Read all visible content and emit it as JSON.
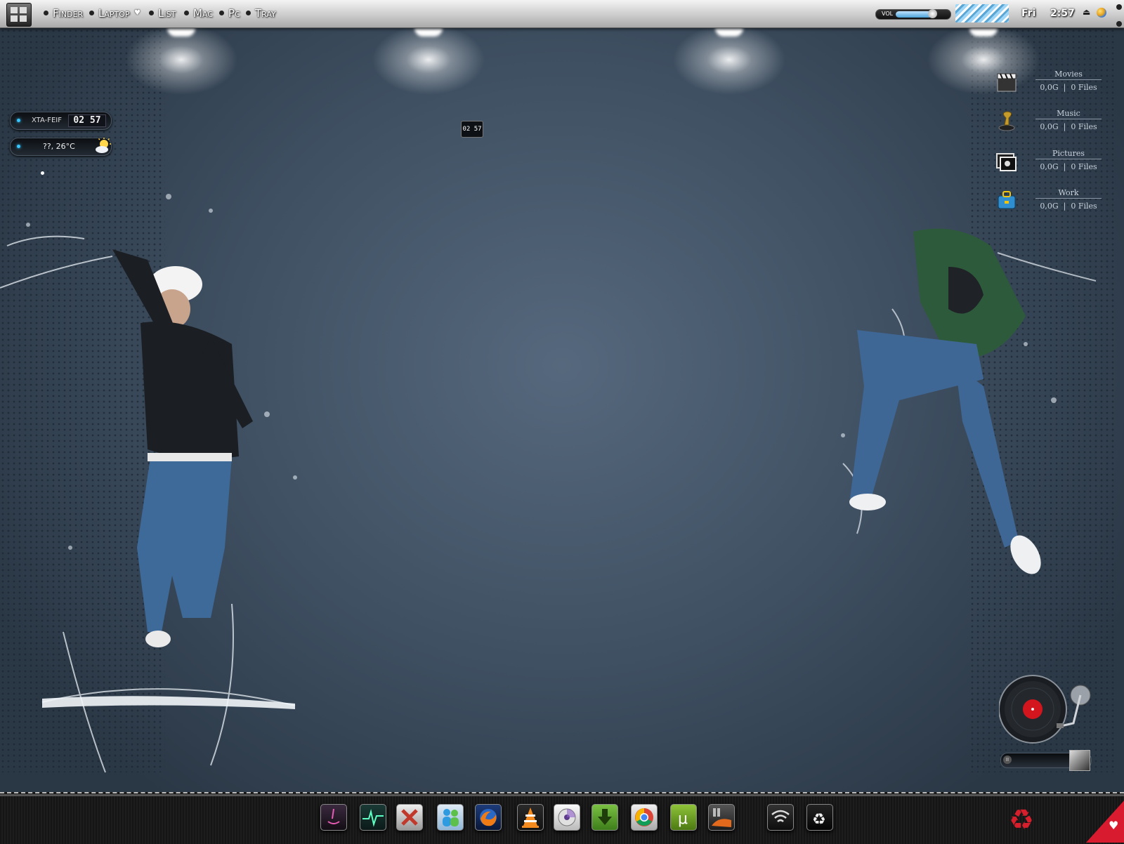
{
  "topbar": {
    "menu": [
      "Finder",
      "Laptop",
      "List",
      "Mac",
      "Pc",
      "Tray"
    ],
    "volume_label": "VOL",
    "volume_level": 0.72,
    "day": "Fri",
    "time": "2:57",
    "eject": "⏏"
  },
  "widgets": {
    "clock_label": "XTA-FEIF",
    "clock_digits": "02 57",
    "weather_text": "??, 26°C",
    "center_clock": "02 57"
  },
  "folders": [
    {
      "name": "Movies",
      "size": "0,0G",
      "files": "0 Files",
      "icon": "clapperboard-icon"
    },
    {
      "name": "Music",
      "size": "0,0G",
      "files": "0 Files",
      "icon": "gramophone-icon"
    },
    {
      "name": "Pictures",
      "size": "0,0G",
      "files": "0 Files",
      "icon": "picture-frame-icon"
    },
    {
      "name": "Work",
      "size": "0,0G",
      "files": "0 Files",
      "icon": "briefcase-icon"
    }
  ],
  "player": {
    "pause_symbol": "II"
  },
  "dock": {
    "icons": [
      "finder-icon",
      "activity-monitor-icon",
      "crossover-icon",
      "messenger-icon",
      "firefox-icon",
      "vlc-icon",
      "itunes-icon",
      "download-manager-icon",
      "chrome-icon",
      "utorrent-icon",
      "film-icon",
      "wifi-icon",
      "recycle-bin-icon"
    ]
  },
  "colors": {
    "accent_red": "#d81b2e",
    "led_blue": "#38c6ff"
  }
}
